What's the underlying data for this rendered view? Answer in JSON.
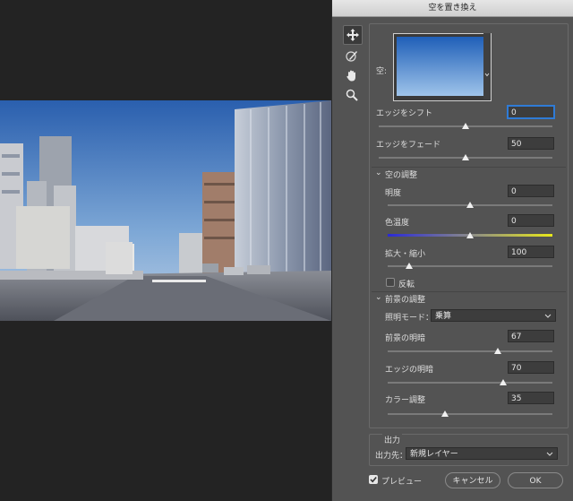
{
  "dialog": {
    "title": "空を置き換え"
  },
  "tools": [
    "move-icon",
    "brush-icon",
    "hand-icon",
    "zoom-icon"
  ],
  "sky": {
    "label": "空:",
    "preview_top": "#1f5fb8",
    "preview_bottom": "#9fc4ea"
  },
  "edge_shift": {
    "label": "エッジをシフト",
    "value": "0",
    "level": 0.5
  },
  "edge_fade": {
    "label": "エッジをフェード",
    "value": "50",
    "level": 0.5
  },
  "sky_adjust": {
    "header": "空の調整",
    "brightness": {
      "label": "明度",
      "value": "0",
      "level": 0.5
    },
    "temperature": {
      "label": "色温度",
      "value": "0",
      "level": 0.5
    },
    "scale": {
      "label": "拡大・縮小",
      "value": "100",
      "level": 0.1
    },
    "flip_label": "反転"
  },
  "foreground_adjust": {
    "header": "前景の調整",
    "lighting_mode_label": "照明モード：",
    "lighting_mode_value": "乗算",
    "fg_lighting": {
      "label": "前景の明暗",
      "value": "67",
      "level": 0.67
    },
    "edge_lighting": {
      "label": "エッジの明暗",
      "value": "70",
      "level": 0.7
    },
    "color_adjust": {
      "label": "カラー調整",
      "value": "35",
      "level": 0.35
    }
  },
  "output": {
    "header": "出力",
    "label": "出力先：",
    "value": "新規レイヤー"
  },
  "footer": {
    "preview_label": "プレビュー",
    "preview_checked": true,
    "cancel_label": "キャンセル",
    "ok_label": "OK"
  }
}
